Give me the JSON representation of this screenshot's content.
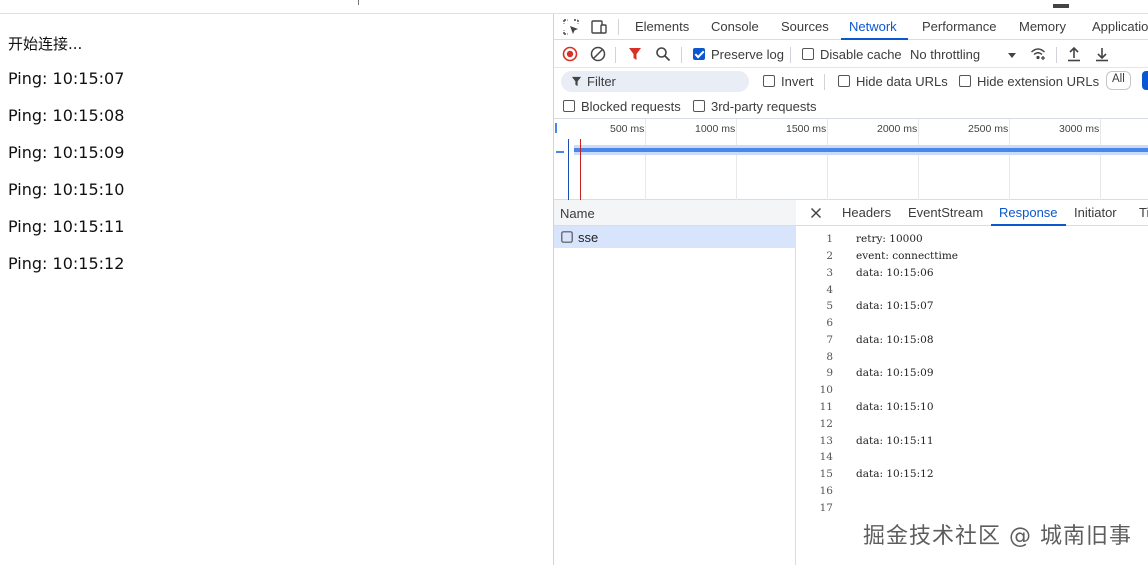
{
  "page": {
    "lines": [
      "开始连接...",
      "Ping: 10:15:07",
      "Ping: 10:15:08",
      "Ping: 10:15:09",
      "Ping: 10:15:10",
      "Ping: 10:15:11",
      "Ping: 10:15:12"
    ]
  },
  "devtools": {
    "tabs": [
      "Elements",
      "Console",
      "Sources",
      "Network",
      "Performance",
      "Memory",
      "Applicatio"
    ],
    "active_tab": "Network",
    "toolbar": {
      "preserve_log": "Preserve log",
      "disable_cache": "Disable cache",
      "throttling": "No throttling"
    },
    "filter": {
      "placeholder": "Filter",
      "invert": "Invert",
      "hide_data_urls": "Hide data URLs",
      "hide_extension_urls": "Hide extension URLs",
      "all": "All"
    },
    "options": {
      "blocked_requests": "Blocked requests",
      "third_party": "3rd-party requests"
    },
    "timeline": {
      "ticks": [
        "500 ms",
        "1000 ms",
        "1500 ms",
        "2000 ms",
        "2500 ms",
        "3000 ms"
      ]
    },
    "requests": {
      "header": "Name",
      "items": [
        "sse"
      ]
    },
    "detail": {
      "tabs": [
        "Headers",
        "EventStream",
        "Response",
        "Initiator",
        "Ti"
      ],
      "active_tab": "Response",
      "response_lines": [
        {
          "n": "1",
          "t": "retry: 10000"
        },
        {
          "n": "2",
          "t": "event: connecttime"
        },
        {
          "n": "3",
          "t": "data: 10:15:06"
        },
        {
          "n": "4",
          "t": ""
        },
        {
          "n": "5",
          "t": "data: 10:15:07"
        },
        {
          "n": "6",
          "t": ""
        },
        {
          "n": "7",
          "t": "data: 10:15:08"
        },
        {
          "n": "8",
          "t": ""
        },
        {
          "n": "9",
          "t": "data: 10:15:09"
        },
        {
          "n": "10",
          "t": ""
        },
        {
          "n": "11",
          "t": "data: 10:15:10"
        },
        {
          "n": "12",
          "t": ""
        },
        {
          "n": "13",
          "t": "data: 10:15:11"
        },
        {
          "n": "14",
          "t": ""
        },
        {
          "n": "15",
          "t": "data: 10:15:12"
        },
        {
          "n": "16",
          "t": ""
        },
        {
          "n": "17",
          "t": ""
        }
      ]
    }
  },
  "watermark": "掘金技术社区 @ 城南旧事",
  "colors": {
    "accent": "#0b57d0",
    "record_red": "#d93025",
    "timeline_blue": "#4a86e8",
    "selected_row": "#d7e4fb"
  },
  "icons": [
    "inspect-element-icon",
    "device-toolbar-icon",
    "record-icon",
    "clear-icon",
    "filter-funnel-icon",
    "search-icon",
    "dropdown-arrow-icon",
    "network-conditions-icon",
    "upload-icon",
    "download-icon",
    "close-icon"
  ]
}
